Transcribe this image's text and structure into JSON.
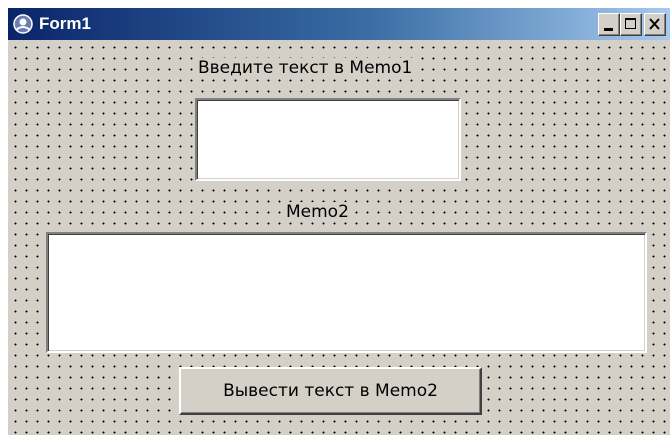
{
  "window": {
    "title": "Form1",
    "icon": "delphi-form-icon",
    "controls": [
      "minimize-icon",
      "maximize-icon",
      "close-icon"
    ]
  },
  "form": {
    "label1": "Введите текст в Memo1",
    "memo1_value": "",
    "label2": "Memo2",
    "memo2_value": "",
    "button_label": "Вывести текст в Memo2"
  },
  "colors": {
    "face": "#d4d0c8",
    "title_start": "#0a246a",
    "title_end": "#a6caf0",
    "memo_bg": "#ffffff"
  }
}
